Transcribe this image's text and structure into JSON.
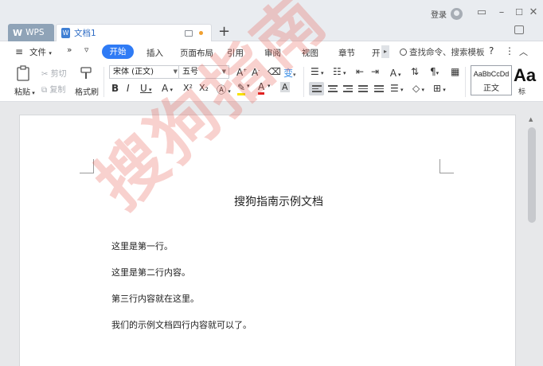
{
  "tabs": {
    "wps_label": "WPS",
    "doc_label": "文档1"
  },
  "titlebar": {
    "login": "登录"
  },
  "menu": {
    "file": "文件",
    "items": [
      "开始",
      "插入",
      "页面布局",
      "引用",
      "审阅",
      "视图",
      "章节",
      "开"
    ],
    "search": "查找命令、搜索模板"
  },
  "ribbon": {
    "paste": "粘贴",
    "cut": "剪切",
    "copy": "复制",
    "format_painter": "格式刷",
    "font_name": "宋体 (正文)",
    "font_size": "五号",
    "style_preview": "AaBbCcDd",
    "style_name": "正文",
    "style_next_preview": "Aa",
    "style_next_name": "标"
  },
  "document": {
    "title": "搜狗指南示例文档",
    "lines": [
      "这里是第一行。",
      "这里是第二行内容。",
      "第三行内容就在这里。",
      "我们的示例文档四行内容就可以了。"
    ],
    "watermark": "搜狗指南"
  },
  "colors": {
    "accent": "#2f7bf5",
    "watermark": "#e65a50",
    "titlebar_bg": "#e9ecf0"
  }
}
